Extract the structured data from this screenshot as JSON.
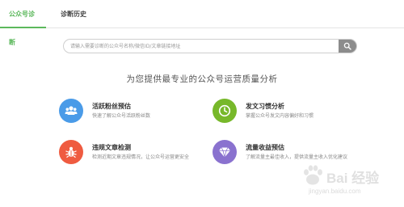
{
  "tabs": {
    "active_label": "公众号诊断",
    "history_label": "诊断历史"
  },
  "search": {
    "placeholder": "请输入需要诊断的公众号名称/微信ID/文章链接地址",
    "button_icon": "search-icon"
  },
  "headline": "为您提供最专业的公众号运营质量分析",
  "features": [
    {
      "title": "活跃粉丝预估",
      "desc": "快速了解公众号活跃粉丝数",
      "icon": "users-icon",
      "color": "#4a9be8"
    },
    {
      "title": "发文习惯分析",
      "desc": "掌握公众号发文内容偏好和习惯",
      "icon": "clock-icon",
      "color": "#77b82a"
    },
    {
      "title": "违规文章检测",
      "desc": "检测近期文章违规情况，让公众号运营更安全",
      "icon": "bug-icon",
      "color": "#ef5b40"
    },
    {
      "title": "流量收益预估",
      "desc": "了解流量主最佳收入，提供流量主收入优化建议",
      "icon": "diamond-icon",
      "color": "#8a72cf"
    }
  ],
  "watermark": {
    "text": "Bai 经验",
    "url": "jingyan.baidu.com"
  },
  "colors": {
    "accent": "#5cb85c",
    "search_button": "#8c8c8c"
  }
}
